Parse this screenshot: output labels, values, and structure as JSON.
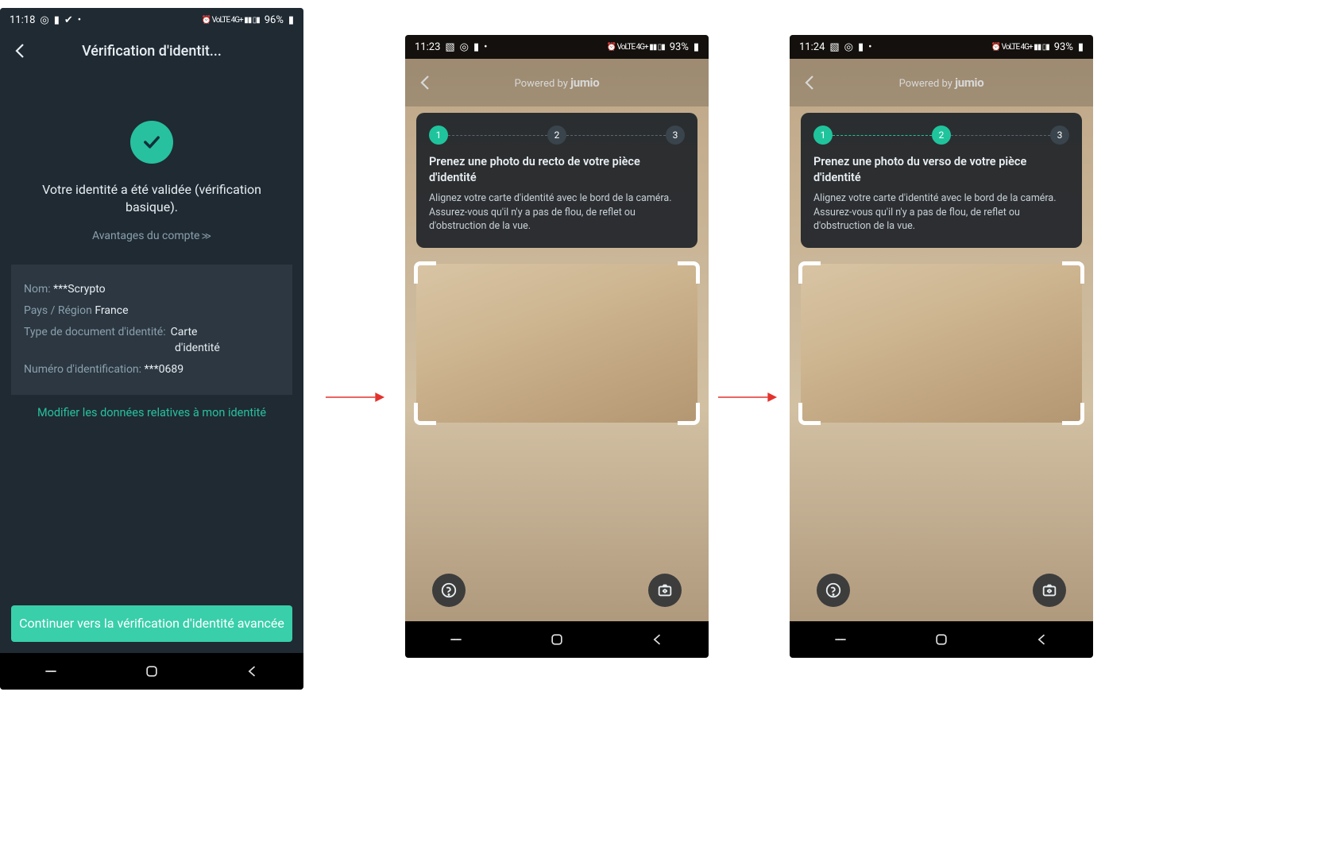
{
  "phone1": {
    "status": {
      "time": "11:18",
      "battery": "96%"
    },
    "header_title": "Vérification d'identit...",
    "validated": "Votre identité a été validée (vérification basique).",
    "advantages": "Avantages du compte",
    "info": {
      "name_label": "Nom:",
      "name_value": "***Scrypto",
      "country_label": "Pays / Région",
      "country_value": "France",
      "doc_label": "Type de document d'identité:",
      "doc_value_l1": "Carte",
      "doc_value_l2": "d'identité",
      "idnum_label": "Numéro d'identification:",
      "idnum_value": "***0689"
    },
    "modify_link": "Modifier les données relatives à mon identité",
    "continue_button": "Continuer vers la vérification d'identité avancée"
  },
  "phone2": {
    "status": {
      "time": "11:23",
      "battery": "93%"
    },
    "powered_by_prefix": "Powered by ",
    "powered_by_brand": "jumio",
    "steps": [
      "1",
      "2",
      "3"
    ],
    "instruction_title": "Prenez une photo du recto de votre pièce d'identité",
    "instruction_body": "Alignez votre carte d'identité avec le bord de la caméra. Assurez-vous qu'il n'y a pas de flou, de reflet ou d'obstruction de la vue."
  },
  "phone3": {
    "status": {
      "time": "11:24",
      "battery": "93%"
    },
    "powered_by_prefix": "Powered by ",
    "powered_by_brand": "jumio",
    "steps": [
      "1",
      "2",
      "3"
    ],
    "instruction_title": "Prenez une photo du verso de votre pièce d'identité",
    "instruction_body": "Alignez votre carte d'identité avec le bord de la caméra. Assurez-vous qu'il n'y a pas de flou, de reflet ou d'obstruction de la vue."
  }
}
